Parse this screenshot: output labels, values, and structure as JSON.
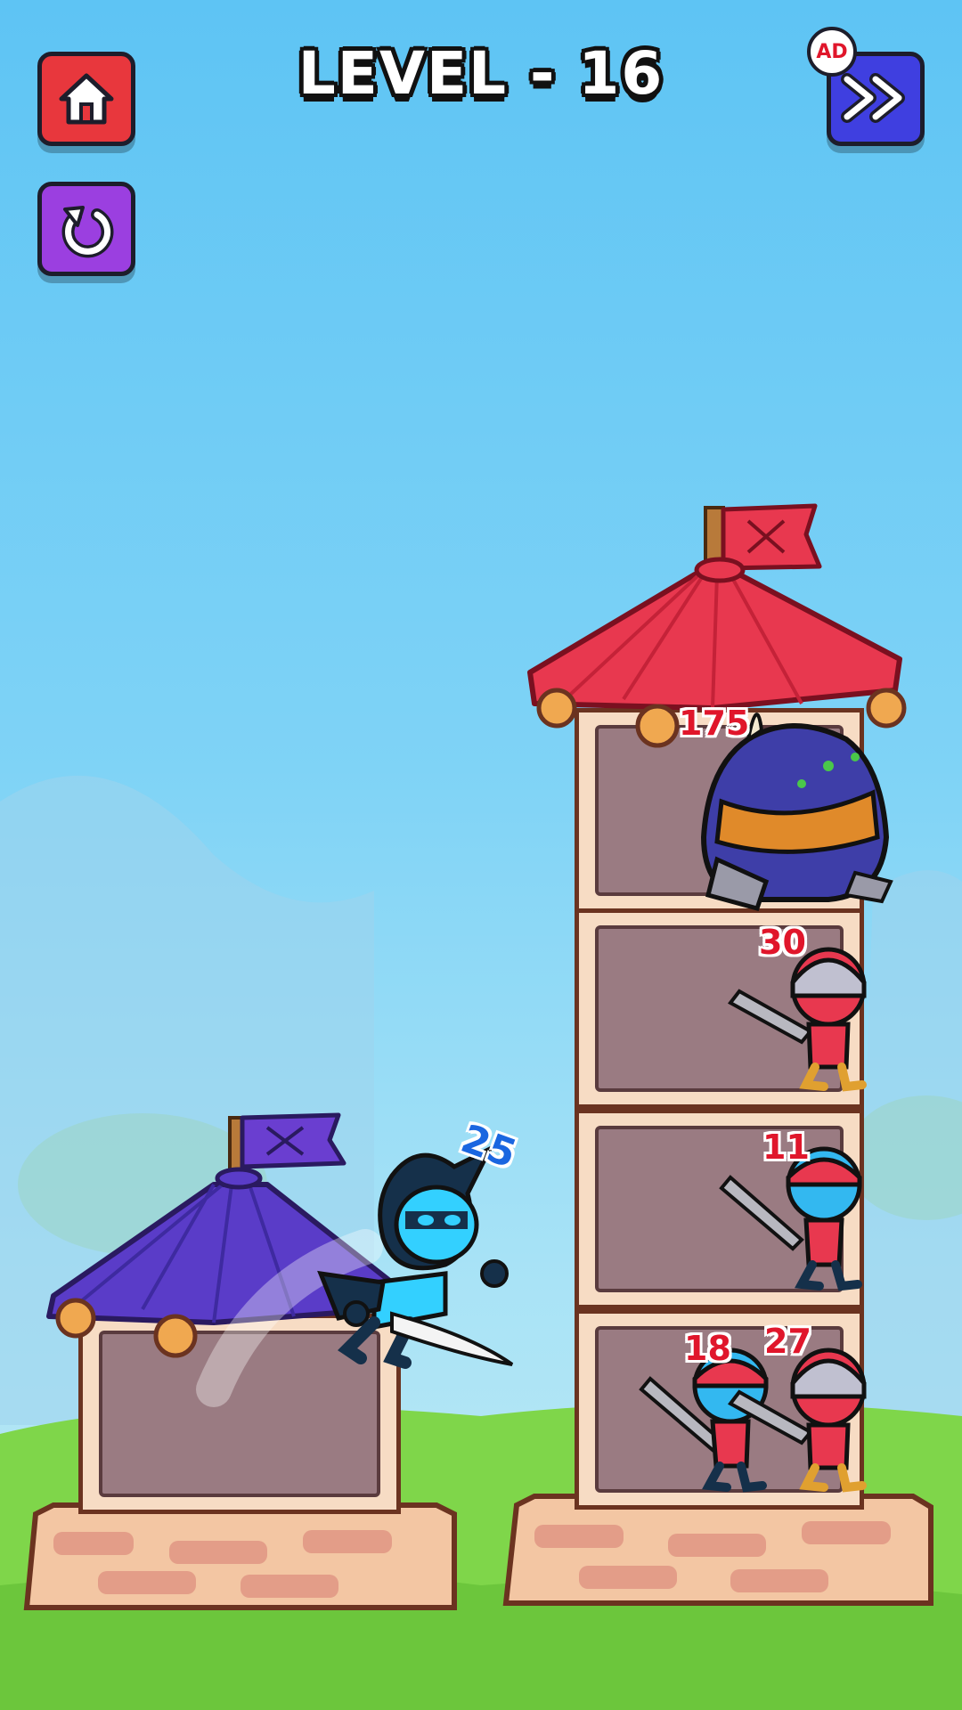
{
  "level_title": "LEVEL - 16",
  "buttons": {
    "home": {
      "icon": "home-icon",
      "color": "#e8373d"
    },
    "restart": {
      "icon": "restart-icon",
      "color": "#9b3fe0"
    },
    "skip": {
      "icon": "fast-forward-icon",
      "color": "#3f3fe0",
      "badge": "AD"
    }
  },
  "player": {
    "power": "25",
    "tower_color": "#5a3cc8"
  },
  "enemy_tower": {
    "roof_color": "#e8384f",
    "floors": [
      {
        "enemies": [
          {
            "type": "ogre-boss",
            "power": "175"
          }
        ]
      },
      {
        "enemies": [
          {
            "type": "helmet-knight",
            "power": "30"
          }
        ]
      },
      {
        "enemies": [
          {
            "type": "bandana-swordsman",
            "power": "11"
          }
        ]
      },
      {
        "enemies": [
          {
            "type": "bandana-swordsman",
            "power": "18"
          },
          {
            "type": "helmet-knight",
            "power": "27"
          }
        ]
      }
    ]
  }
}
